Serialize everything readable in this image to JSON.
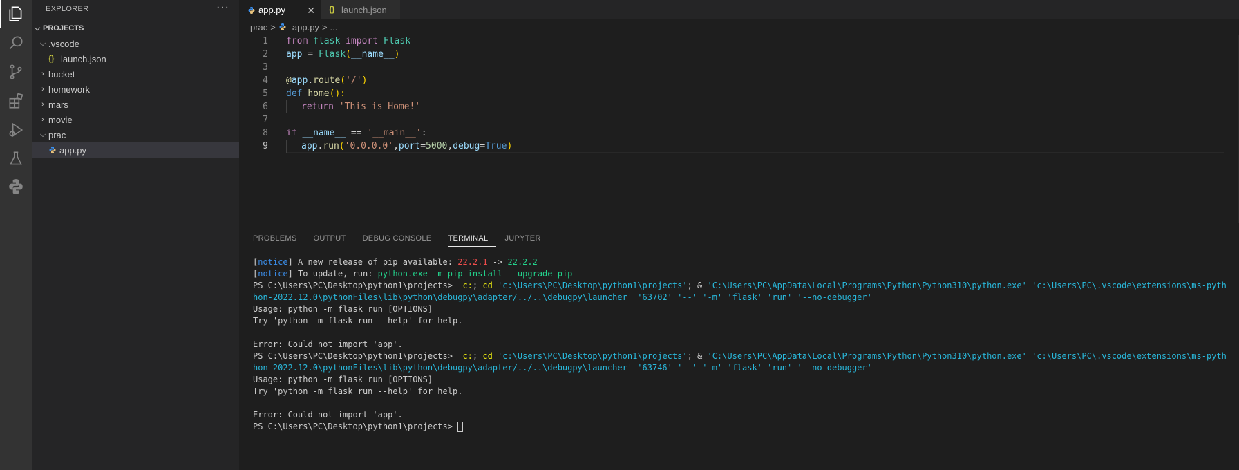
{
  "sidebar": {
    "title": "EXPLORER",
    "more": "···",
    "section": "PROJECTS",
    "items": [
      {
        "label": ".vscode"
      },
      {
        "label": "launch.json"
      },
      {
        "label": "bucket"
      },
      {
        "label": "homework"
      },
      {
        "label": "mars"
      },
      {
        "label": "movie"
      },
      {
        "label": "prac"
      },
      {
        "label": "app.py"
      }
    ]
  },
  "tabs": [
    {
      "label": "app.py",
      "close": "✕"
    },
    {
      "label": "launch.json"
    }
  ],
  "breadcrumb": {
    "folder": "prac",
    "sep1": ">",
    "file": "app.py",
    "sep2": ">",
    "more": "..."
  },
  "editor": {
    "line_numbers": [
      "1",
      "2",
      "3",
      "4",
      "5",
      "6",
      "7",
      "8",
      "9"
    ],
    "lines": {
      "l1": [
        "from",
        " ",
        "flask",
        " ",
        "import",
        " ",
        "Flask"
      ],
      "l2": [
        "app",
        " = ",
        "Flask",
        "(",
        "__name__",
        ")"
      ],
      "l4": [
        "@",
        "app",
        ".",
        "route",
        "(",
        "'/'",
        ")"
      ],
      "l5": [
        "def",
        " ",
        "home",
        "():"
      ],
      "l6": [
        "return",
        " ",
        "'This is Home!'"
      ],
      "l8": [
        "if",
        " ",
        "__name__",
        " == ",
        "'__main__'",
        ":"
      ],
      "l9": [
        "app",
        ".",
        "run",
        "(",
        "'0.0.0.0'",
        ",",
        "port",
        "=",
        "5000",
        ",",
        "debug",
        "=",
        "True",
        ")"
      ]
    }
  },
  "panel": {
    "tabs": [
      "PROBLEMS",
      "OUTPUT",
      "DEBUG CONSOLE",
      "TERMINAL",
      "JUPYTER"
    ],
    "terminal": {
      "notice1": [
        "[",
        "notice",
        "] A new release of pip available: ",
        "22.2.1",
        " -> ",
        "22.2.2"
      ],
      "notice2": [
        "[",
        "notice",
        "] To update, run: ",
        "python.exe -m pip install --upgrade pip"
      ],
      "run1a": [
        "PS C:\\Users\\PC\\Desktop\\python1\\projects>  ",
        "c:",
        "; ",
        "cd",
        " ",
        "'c:\\Users\\PC\\Desktop\\python1\\projects'",
        "; & ",
        "'C:\\Users\\PC\\AppData\\Local\\Programs\\Python\\Python310\\python.exe'",
        " ",
        "'c:\\Users\\PC\\.vscode\\extensions\\ms-python.pyt"
      ],
      "run1b": "hon-2022.12.0\\pythonFiles\\lib\\python\\debugpy\\adapter/../..\\debugpy\\launcher' '63702' '--' '-m' 'flask' 'run' '--no-debugger'",
      "usage": "Usage: python -m flask run [OPTIONS]",
      "try": "Try 'python -m flask run --help' for help.",
      "error": "Error: Could not import 'app'.",
      "run2a": [
        "PS C:\\Users\\PC\\Desktop\\python1\\projects>  ",
        "c:",
        "; ",
        "cd",
        " ",
        "'c:\\Users\\PC\\Desktop\\python1\\projects'",
        "; & ",
        "'C:\\Users\\PC\\AppData\\Local\\Programs\\Python\\Python310\\python.exe'",
        " ",
        "'c:\\Users\\PC\\.vscode\\extensions\\ms-python.pyt"
      ],
      "run2b": "hon-2022.12.0\\pythonFiles\\lib\\python\\debugpy\\adapter/../..\\debugpy\\launcher' '63746' '--' '-m' 'flask' 'run' '--no-debugger'",
      "prompt": "PS C:\\Users\\PC\\Desktop\\python1\\projects> "
    }
  }
}
